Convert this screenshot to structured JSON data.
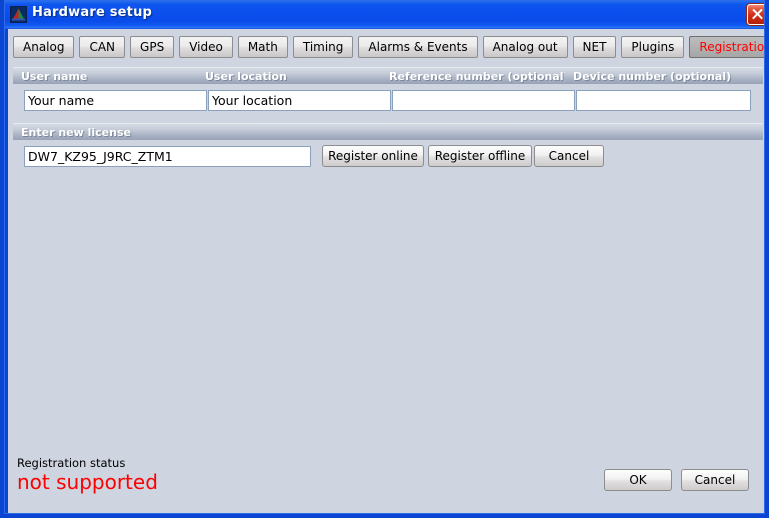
{
  "window": {
    "title": "Hardware setup",
    "icon": "app-pyramid-icon",
    "close_label": "✕",
    "frame_color": "#0a46d2",
    "client_bg": "#ced4e0"
  },
  "tabs": [
    {
      "label": "Analog",
      "selected": false
    },
    {
      "label": "CAN",
      "selected": false
    },
    {
      "label": "GPS",
      "selected": false
    },
    {
      "label": "Video",
      "selected": false
    },
    {
      "label": "Math",
      "selected": false
    },
    {
      "label": "Timing",
      "selected": false
    },
    {
      "label": "Alarms & Events",
      "selected": false
    },
    {
      "label": "Analog out",
      "selected": false
    },
    {
      "label": "NET",
      "selected": false
    },
    {
      "label": "Plugins",
      "selected": false
    },
    {
      "label": "Registration",
      "selected": true
    }
  ],
  "selected_tab_color": "#ff0000",
  "fields": [
    {
      "header": "User name",
      "value": "Your name",
      "placeholder": ""
    },
    {
      "header": "User location",
      "value": "Your location",
      "placeholder": ""
    },
    {
      "header": "Reference number (optional)",
      "value": "",
      "placeholder": ""
    },
    {
      "header": "Device number (optional)",
      "value": "",
      "placeholder": ""
    }
  ],
  "license": {
    "header": "Enter new license",
    "key": "DW7_KZ95_J9RC_ZTM1",
    "placeholder": "",
    "buttons": [
      {
        "label": "Register online"
      },
      {
        "label": "Register offline"
      },
      {
        "label": "Cancel"
      }
    ]
  },
  "status": {
    "label": "Registration status",
    "value": "not supported",
    "value_color": "#ff0000"
  },
  "footer": {
    "ok_label": "OK",
    "cancel_label": "Cancel"
  }
}
